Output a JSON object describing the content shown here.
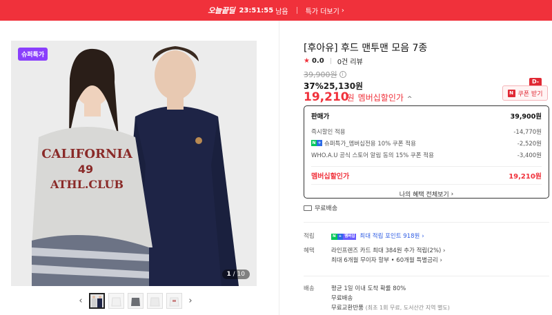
{
  "promo": {
    "brand": "오늘끝딜",
    "timer": "23:51:55",
    "timer_suffix": "남음",
    "more_label": "특가 더보기"
  },
  "gallery": {
    "badge": "슈퍼특가",
    "counter_current": "1",
    "counter_total": "/ 10",
    "image_text_1": "CALIFORNIA",
    "image_text_2": "49",
    "image_text_3": "ATHL.CLUB"
  },
  "product": {
    "title": "[후아유] 후드 맨투맨 모음 7종",
    "rating": "0.0",
    "reviews": "0건 리뷰",
    "original_price": "39,900원",
    "discount_pct": "37%",
    "discount_price": "25,130원",
    "member_price": "19,210",
    "member_price_unit": "원",
    "member_price_label": "멤버십할인가"
  },
  "coupon": {
    "dday": "D-1",
    "label": "쿠폰 받기",
    "logo": "N"
  },
  "price_box": {
    "head_label": "판매가",
    "head_value": "39,900원",
    "rows": [
      {
        "label": "즉시할인 적용",
        "value": "-14,770원"
      },
      {
        "label": "슈퍼특가_멤버십전용 10% 쿠폰 적용",
        "value": "-2,520원"
      },
      {
        "label": "WHO.A.U 공식 스토어 알림 동의 15% 쿠폰 적용",
        "value": "-3,400원"
      }
    ],
    "total_label": "멤버십할인가",
    "total_value": "19,210원",
    "benefit_link": "나의 혜택 전체보기"
  },
  "shipping_free": "무료배송",
  "info": {
    "points_key": "적립",
    "points_badge": "멤버십",
    "points_value": "최대 적립 포인트 918원",
    "benefit_key": "혜택",
    "benefit_line1": "라인프렌즈 카드 최대 384원 추가 적립(2%)",
    "benefit_line2": "최대 6개월 무이자 할부 • 60개월 특별금리",
    "delivery_key": "배송",
    "delivery_line1": "평균 1일 이내 도착 확률 80%",
    "delivery_line2": "무료배송",
    "delivery_line3": "무료교환반품",
    "delivery_line3_note": "(최초 1회 무료, 도서산간 지역 별도)"
  }
}
